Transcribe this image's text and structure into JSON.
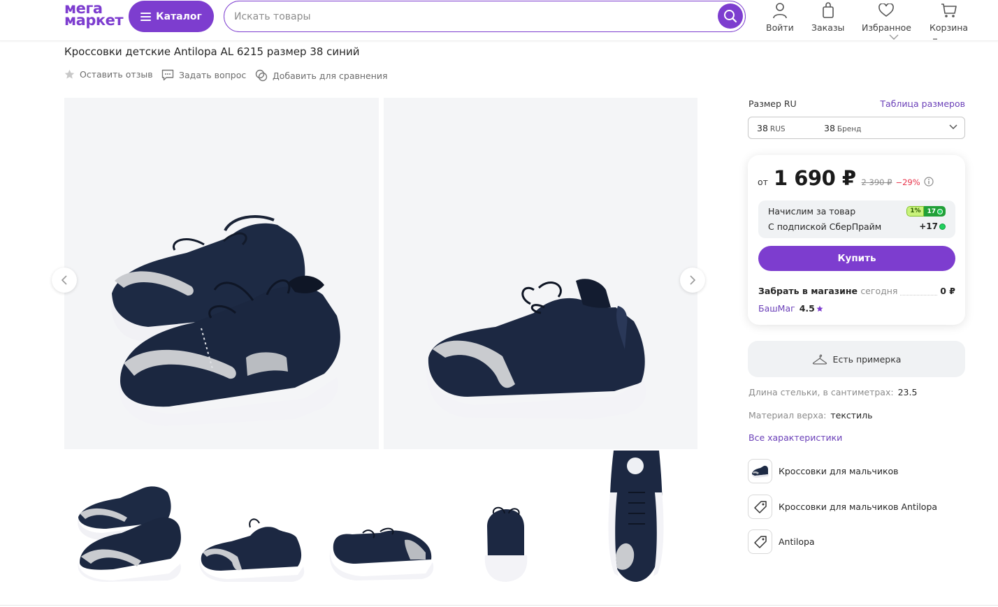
{
  "header": {
    "logo_line1": "мега",
    "logo_line2": "маркет",
    "catalog_label": "Каталог",
    "search_placeholder": "Искать товары",
    "links": {
      "login": "Войти",
      "orders": "Заказы",
      "favorites": "Избранное",
      "cart": "Корзина"
    }
  },
  "product": {
    "title": "Кроссовки детские Antilopa AL 6215 размер 38 синий",
    "actions": {
      "review": "Оставить отзыв",
      "question": "Задать вопрос",
      "compare": "Добавить для сравнения"
    }
  },
  "size": {
    "label": "Размер RU",
    "table_link": "Таблица размеров",
    "selected_ru_value": "38",
    "selected_ru_unit": "RUS",
    "selected_brand_value": "38",
    "selected_brand_unit": "Бренд"
  },
  "price": {
    "from": "от",
    "current": "1 690 ₽",
    "old": "2 390 ₽",
    "discount": "−29%"
  },
  "bonus": {
    "line1": "Начислим за товар",
    "line2": "С подпиской СберПрайм",
    "badge_percent": "1%",
    "badge_points": "17",
    "prime_points": "+17"
  },
  "buy_label": "Купить",
  "pickup": {
    "label": "Забрать в магазине",
    "when": "сегодня",
    "price": "0 ₽",
    "store": "БашМаг",
    "rating": "4.5"
  },
  "tryon_label": "Есть примерка",
  "specs": [
    {
      "key": "Длина стельки, в сантиметрах:",
      "value": "23.5"
    },
    {
      "key": "Материал верха:",
      "value": "текстиль"
    }
  ],
  "all_specs_link": "Все характеристики",
  "related": [
    {
      "label": "Кроссовки для мальчиков",
      "icon": "shoe-thumb-icon"
    },
    {
      "label": "Кроссовки для мальчиков Antilopa",
      "icon": "tag-icon"
    },
    {
      "label": "Antilopa",
      "icon": "tag-icon"
    }
  ],
  "colors": {
    "brand": "#7d3dcf",
    "link": "#6a3fb8",
    "discount": "#e8334a",
    "sber_green": "#21a038",
    "shoe_navy": "#1d2a44",
    "sole_white": "#f4f4f8"
  }
}
